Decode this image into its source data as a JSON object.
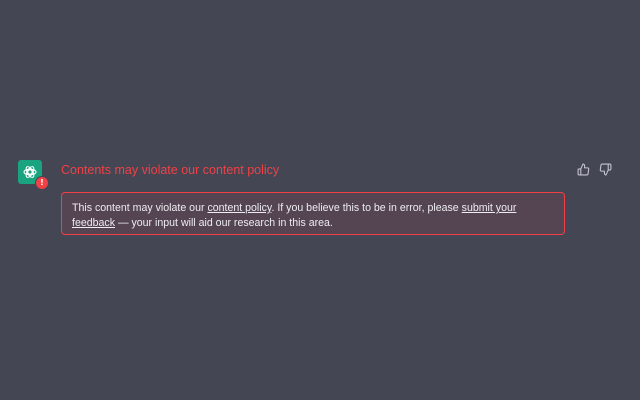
{
  "message": {
    "title": "Contents may violate our content policy",
    "notice": {
      "part1": "This content may violate our ",
      "link1": "content policy",
      "part2": ". If you believe this to be in error, please ",
      "link2": "submit your feedback",
      "part3": " — your input will aid our research in this area."
    },
    "badge_symbol": "!"
  },
  "icons": {
    "avatar": "openai-logo-icon",
    "badge": "warning-icon",
    "thumbs_up": "thumbs-up-icon",
    "thumbs_down": "thumbs-down-icon"
  },
  "colors": {
    "background": "#444654",
    "error": "#ef4146",
    "avatar_bg": "#19a37f",
    "text": "#ececf1",
    "icon": "#c5c5d2"
  }
}
